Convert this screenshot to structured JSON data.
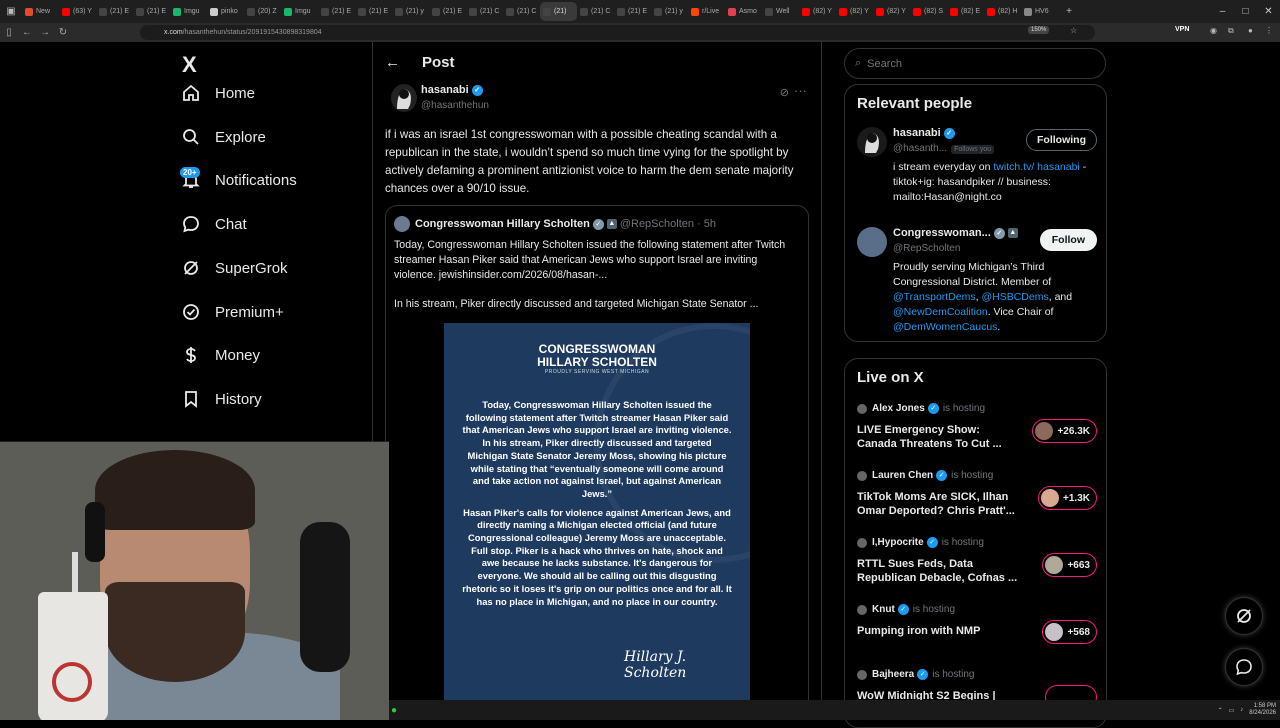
{
  "browser": {
    "tabs": [
      {
        "label": "New",
        "icon": "browser-icon",
        "color": "#e34c26"
      },
      {
        "label": "(63) Y",
        "icon": "youtube-icon",
        "color": "#ff0000"
      },
      {
        "label": "(21) E",
        "icon": "x-icon",
        "color": "#444"
      },
      {
        "label": "(21) E",
        "icon": "x-icon",
        "color": "#444"
      },
      {
        "label": "Imgu",
        "icon": "imgur-icon",
        "color": "#1bb76e"
      },
      {
        "label": "pinko",
        "icon": "pink-icon",
        "color": "#cccccc"
      },
      {
        "label": "(20) Z",
        "icon": "x-icon",
        "color": "#444"
      },
      {
        "label": "Imgu",
        "icon": "imgur-icon",
        "color": "#1bb76e"
      },
      {
        "label": "(21) E",
        "icon": "x-icon",
        "color": "#444"
      },
      {
        "label": "(21) E",
        "icon": "x-icon",
        "color": "#444"
      },
      {
        "label": "(21) y",
        "icon": "x-icon",
        "color": "#444"
      },
      {
        "label": "(21) E",
        "icon": "x-icon",
        "color": "#444"
      },
      {
        "label": "(21) C",
        "icon": "x-icon",
        "color": "#444"
      },
      {
        "label": "(21) C",
        "icon": "x-icon",
        "color": "#444"
      },
      {
        "label": "(21)",
        "icon": "x-icon",
        "color": "#444",
        "active": true
      },
      {
        "label": "(21) C",
        "icon": "x-icon",
        "color": "#444"
      },
      {
        "label": "(21) E",
        "icon": "x-icon",
        "color": "#444"
      },
      {
        "label": "(21) y",
        "icon": "x-icon",
        "color": "#444"
      },
      {
        "label": "r/Live",
        "icon": "reddit-icon",
        "color": "#ff4500"
      },
      {
        "label": "Asmo",
        "icon": "app-icon",
        "color": "#e04050"
      },
      {
        "label": "Well",
        "icon": "x-icon",
        "color": "#444"
      },
      {
        "label": "(82) Y",
        "icon": "youtube-icon",
        "color": "#ff0000"
      },
      {
        "label": "(82) Y",
        "icon": "youtube-icon",
        "color": "#ff0000"
      },
      {
        "label": "(82) Y",
        "icon": "youtube-icon",
        "color": "#ff0000"
      },
      {
        "label": "(82) S",
        "icon": "youtube-icon",
        "color": "#ff0000"
      },
      {
        "label": "(82) E",
        "icon": "youtube-icon",
        "color": "#ff0000"
      },
      {
        "label": "(82) H",
        "icon": "youtube-icon",
        "color": "#ff0000"
      },
      {
        "label": "HV6",
        "icon": "app-icon",
        "color": "#888"
      }
    ],
    "url_host": "x.com",
    "url_path": "/hasanthehun/status/2091915430898319804",
    "zoom": "150%",
    "vpn_label": "VPN"
  },
  "leftnav": {
    "logo": "X",
    "items": [
      {
        "label": "Home",
        "icon": "home-icon"
      },
      {
        "label": "Explore",
        "icon": "search-icon"
      },
      {
        "label": "Notifications",
        "icon": "bell-icon",
        "badge": "20+"
      },
      {
        "label": "Chat",
        "icon": "chat-icon"
      },
      {
        "label": "SuperGrok",
        "icon": "grok-icon"
      },
      {
        "label": "Premium+",
        "icon": "verified-badge-icon"
      },
      {
        "label": "Money",
        "icon": "dollar-icon"
      },
      {
        "label": "History",
        "icon": "bookmark-icon"
      }
    ]
  },
  "post": {
    "header_title": "Post",
    "author_name": "hasanabi",
    "author_handle": "@hasanthehun",
    "text": "if i was an israel 1st congresswoman with a possible cheating scandal with a republican in the state, i wouldn’t spend so much time vying for the spotlight by actively defaming a prominent antizionist voice to harm the dem senate majority chances over a 90/10 issue.",
    "quote": {
      "name": "Congresswoman Hillary Scholten",
      "handle": "@RepScholten",
      "time": "· 5h",
      "text": "Today, Congresswoman Hillary Scholten issued the following statement after Twitch streamer Hasan Piker said that American Jews who support Israel are inviting violence. jewishinsider.com/2026/08/hasan-...",
      "text2": "In his stream, Piker directly discussed and targeted Michigan State Senator ...",
      "statement_title_1": "CONGRESSWOMAN",
      "statement_title_2": "HILLARY SCHOLTEN",
      "statement_sub": "PROUDLY SERVING WEST MICHIGAN",
      "statement_body_1": "Today, Congresswoman Hillary Scholten issued the following statement after Twitch streamer Hasan Piker said that American Jews who support Israel are inviting violence. In his stream, Piker directly discussed and targeted Michigan State Senator Jeremy Moss, showing his picture while stating that “eventually someone will come around and take action not against Israel, but against American Jews.”",
      "statement_body_2": "Hasan Piker's calls for violence against American Jews, and directly naming a Michigan elected official (and future Congressional colleague) Jeremy Moss are unacceptable. Full stop. Piker is a hack who thrives on hate, shock and awe because he lacks substance. It's dangerous for everyone. We should all be calling out this disgusting rhetoric so it loses it's grip on our politics once and for all. It has no place in Michigan, and no place in our country.",
      "signature": "Hillary J. Scholten"
    }
  },
  "right": {
    "search_placeholder": "Search",
    "relevant_title": "Relevant people",
    "people": [
      {
        "name": "hasanabi",
        "handle": "@hasanth...",
        "follows_you": "Follows you",
        "button": "Following",
        "bio_1": "i stream everyday on ",
        "bio_link1": "twitch.tv/ hasanabi",
        "bio_2": " - tiktok+ig: hasandpiker // business: mailto:Hasan@night.co"
      },
      {
        "name": "Congresswoman...",
        "handle": "@RepScholten",
        "button": "Follow",
        "bio_1": "Proudly serving Michigan’s Third Congressional District. Member of ",
        "bio_link1": "@TransportDems",
        "bio_sep1": ", ",
        "bio_link2": "@HSBCDems",
        "bio_sep2": ", and ",
        "bio_link3": "@NewDemCoalition",
        "bio_sep3": ". Vice Chair of ",
        "bio_link4": "@DemWomenCaucus",
        "bio_end": "."
      }
    ],
    "live_title": "Live on X",
    "hosting_label": "is hosting",
    "live": [
      {
        "host": "Alex Jones",
        "title": "LIVE Emergency Show: Canada Threatens To Cut ...",
        "count": "+26.3K"
      },
      {
        "host": "Lauren Chen",
        "title": "TikTok Moms Are SICK, Ilhan Omar Deported? Chris Pratt'...",
        "count": "+1.3K"
      },
      {
        "host": "I,Hypocrite",
        "title": "RTTL Sues Feds, Data Republican Debacle, Cofnas ...",
        "count": "+663"
      },
      {
        "host": "Knut",
        "title": "Pumping iron with NMP",
        "count": "+568"
      },
      {
        "host": "Bajheera",
        "title": "WoW Midnight S2 Begins |",
        "count": ""
      }
    ]
  },
  "taskbar": {
    "time": "1:58 PM",
    "date": "8/24/2026"
  },
  "colors": {
    "accent": "#1d9bf0",
    "live_pink": "#f91880",
    "statement_bg": "#1f3a5f"
  }
}
